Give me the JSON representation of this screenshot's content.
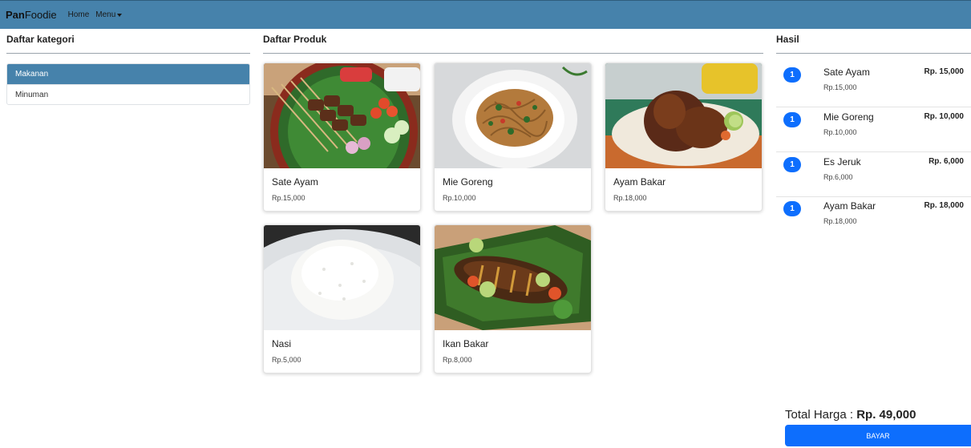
{
  "navbar": {
    "brand_bold": "Pan",
    "brand_rest": "Foodie",
    "links": [
      {
        "label": "Home"
      },
      {
        "label": "Menu"
      }
    ]
  },
  "categories": {
    "heading": "Daftar kategori",
    "items": [
      {
        "label": "Makanan",
        "active": true
      },
      {
        "label": "Minuman",
        "active": false
      }
    ]
  },
  "products": {
    "heading": "Daftar Produk",
    "items": [
      {
        "name": "Sate Ayam",
        "price": "Rp.15,000",
        "image": "sate-ayam-photo"
      },
      {
        "name": "Mie Goreng",
        "price": "Rp.10,000",
        "image": "mie-goreng-photo"
      },
      {
        "name": "Ayam Bakar",
        "price": "Rp.18,000",
        "image": "ayam-bakar-photo"
      },
      {
        "name": "Nasi",
        "price": "Rp.5,000",
        "image": "nasi-photo"
      },
      {
        "name": "Ikan Bakar",
        "price": "Rp.8,000",
        "image": "ikan-bakar-photo"
      }
    ]
  },
  "result": {
    "heading": "Hasil",
    "items": [
      {
        "qty": "1",
        "name": "Sate Ayam",
        "price": "Rp.15,000",
        "total": "Rp. 15,000"
      },
      {
        "qty": "1",
        "name": "Mie Goreng",
        "price": "Rp.10,000",
        "total": "Rp. 10,000"
      },
      {
        "qty": "1",
        "name": "Es Jeruk",
        "price": "Rp.6,000",
        "total": "Rp. 6,000"
      },
      {
        "qty": "1",
        "name": "Ayam Bakar",
        "price": "Rp.18,000",
        "total": "Rp. 18,000"
      }
    ],
    "total_label": "Total Harga : ",
    "total_value": "Rp. 49,000",
    "pay_label": "BAYAR"
  },
  "colors": {
    "navbar": "#4682ab",
    "primary": "#0d6efd"
  }
}
